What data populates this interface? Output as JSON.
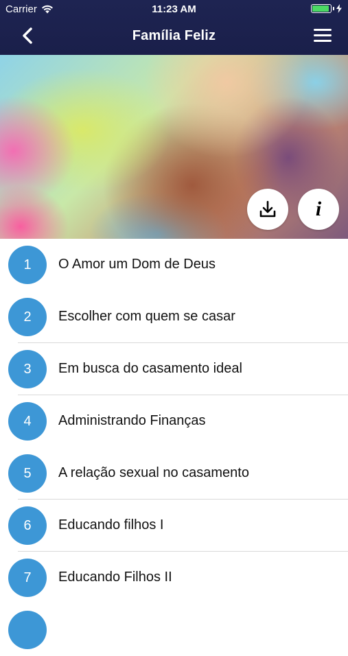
{
  "status": {
    "carrier": "Carrier",
    "time": "11:23 AM",
    "battery_color": "#4cd964"
  },
  "header": {
    "title": "Família Feliz",
    "back_icon": "chevron-left-icon",
    "menu_icon": "hamburger-menu-icon",
    "background_color": "#1e2452"
  },
  "hero": {
    "download_icon": "download-icon",
    "info_icon": "info-icon",
    "info_glyph": "i"
  },
  "accent_color": "#3d97d6",
  "lessons": [
    {
      "number": "1",
      "title": "O Amor um Dom de Deus"
    },
    {
      "number": "2",
      "title": "Escolher com quem se casar"
    },
    {
      "number": "3",
      "title": "Em busca do casamento ideal"
    },
    {
      "number": "4",
      "title": "Administrando Finanças"
    },
    {
      "number": "5",
      "title": "A relação sexual no casamento"
    },
    {
      "number": "6",
      "title": "Educando filhos I"
    },
    {
      "number": "7",
      "title": "Educando Filhos II"
    },
    {
      "number": "",
      "title": ""
    }
  ]
}
